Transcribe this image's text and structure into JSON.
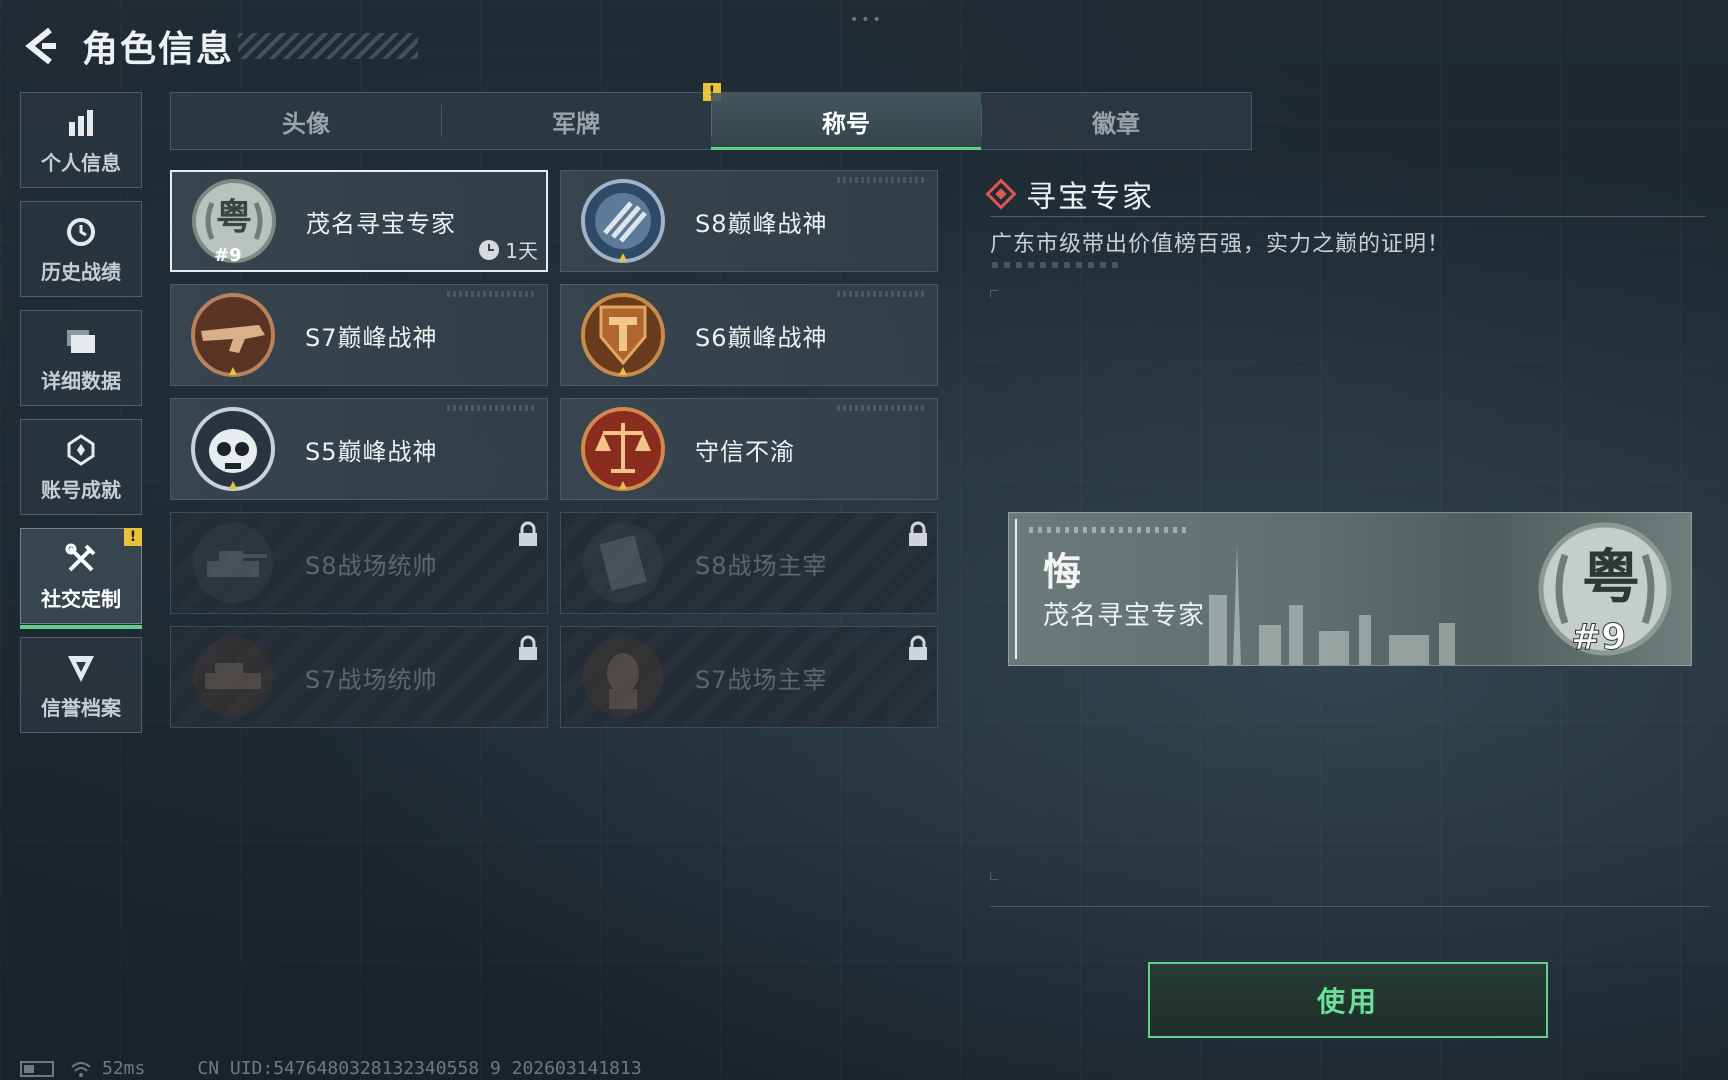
{
  "header": {
    "title": "角色信息"
  },
  "sidebar": {
    "items": [
      {
        "label": "个人信息",
        "icon": "bar-chart-icon"
      },
      {
        "label": "历史战绩",
        "icon": "history-icon"
      },
      {
        "label": "详细数据",
        "icon": "folder-icon"
      },
      {
        "label": "账号成就",
        "icon": "achievement-icon"
      },
      {
        "label": "社交定制",
        "icon": "tools-icon",
        "active": true,
        "warning": "!"
      },
      {
        "label": "信誉档案",
        "icon": "shield-icon"
      }
    ]
  },
  "tabs": [
    {
      "label": "头像"
    },
    {
      "label": "军牌",
      "warning": "!"
    },
    {
      "label": "称号",
      "active": true
    },
    {
      "label": "徽章"
    }
  ],
  "titles": [
    {
      "name": "茂名寻宝专家",
      "badge": "guangdong-emblem-icon",
      "selected": true,
      "timer": "1天",
      "badge_text": "#9"
    },
    {
      "name": "S8巅峰战神",
      "badge": "s8-stripes-emblem-icon"
    },
    {
      "name": "S7巅峰战神",
      "badge": "s7-rifle-emblem-icon"
    },
    {
      "name": "S6巅峰战神",
      "badge": "s6-t-shield-emblem-icon"
    },
    {
      "name": "S5巅峰战神",
      "badge": "s5-skull-emblem-icon"
    },
    {
      "name": "守信不渝",
      "badge": "scales-emblem-icon"
    },
    {
      "name": "S8战场统帅",
      "badge": "tank-emblem-icon",
      "locked": true
    },
    {
      "name": "S8战场主宰",
      "badge": "building-emblem-icon",
      "locked": true
    },
    {
      "name": "S7战场统帅",
      "badge": "vehicle-emblem-icon",
      "locked": true
    },
    {
      "name": "S7战场主宰",
      "badge": "soldier-emblem-icon",
      "locked": true
    }
  ],
  "detail": {
    "title": "寻宝专家",
    "description": "广东市级带出价值榜百强，实力之巅的证明！"
  },
  "banner": {
    "big_char": "悔",
    "name": "茂名寻宝专家",
    "emblem_text": "#9"
  },
  "use_button": {
    "label": "使用"
  },
  "status_bar": {
    "ping": "52ms",
    "uid": "CN UID:5476480328132340558 9 202603141813"
  },
  "colors": {
    "accent": "#5fd08a",
    "warning": "#e8c23a",
    "diamond": "#e0574f"
  }
}
